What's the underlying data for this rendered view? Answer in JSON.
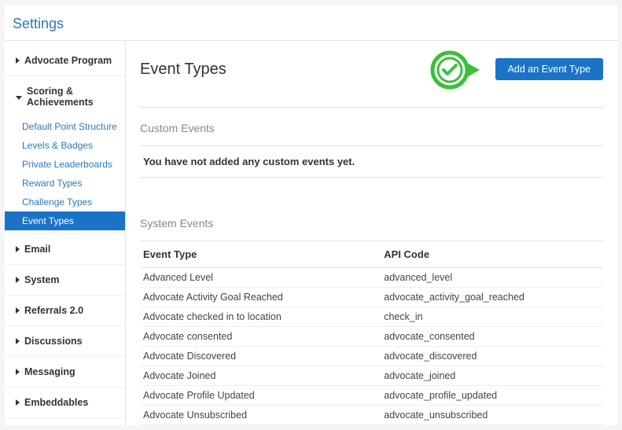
{
  "header": {
    "title": "Settings"
  },
  "sidebar": {
    "groups": [
      {
        "label": "Advocate Program",
        "expanded": false,
        "items": []
      },
      {
        "label": "Scoring & Achievements",
        "expanded": true,
        "items": [
          {
            "label": "Default Point Structure",
            "active": false
          },
          {
            "label": "Levels & Badges",
            "active": false
          },
          {
            "label": "Private Leaderboards",
            "active": false
          },
          {
            "label": "Reward Types",
            "active": false
          },
          {
            "label": "Challenge Types",
            "active": false
          },
          {
            "label": "Event Types",
            "active": true
          }
        ]
      },
      {
        "label": "Email",
        "expanded": false,
        "items": []
      },
      {
        "label": "System",
        "expanded": false,
        "items": []
      },
      {
        "label": "Referrals 2.0",
        "expanded": false,
        "items": []
      },
      {
        "label": "Discussions",
        "expanded": false,
        "items": []
      },
      {
        "label": "Messaging",
        "expanded": false,
        "items": []
      },
      {
        "label": "Embeddables",
        "expanded": false,
        "items": []
      }
    ]
  },
  "main": {
    "title": "Event Types",
    "add_button": "Add an Event Type",
    "badge_icon": "check-circle",
    "custom": {
      "heading": "Custom Events",
      "empty": "You have not added any custom events yet."
    },
    "system": {
      "heading": "System Events",
      "columns": [
        "Event Type",
        "API Code"
      ],
      "rows": [
        {
          "name": "Advanced Level",
          "code": "advanced_level"
        },
        {
          "name": "Advocate Activity Goal Reached",
          "code": "advocate_activity_goal_reached"
        },
        {
          "name": "Advocate checked in to location",
          "code": "check_in"
        },
        {
          "name": "Advocate consented",
          "code": "advocate_consented"
        },
        {
          "name": "Advocate Discovered",
          "code": "advocate_discovered"
        },
        {
          "name": "Advocate Joined",
          "code": "advocate_joined"
        },
        {
          "name": "Advocate Profile Updated",
          "code": "advocate_profile_updated"
        },
        {
          "name": "Advocate Unsubscribed",
          "code": "advocate_unsubscribed"
        }
      ]
    }
  }
}
